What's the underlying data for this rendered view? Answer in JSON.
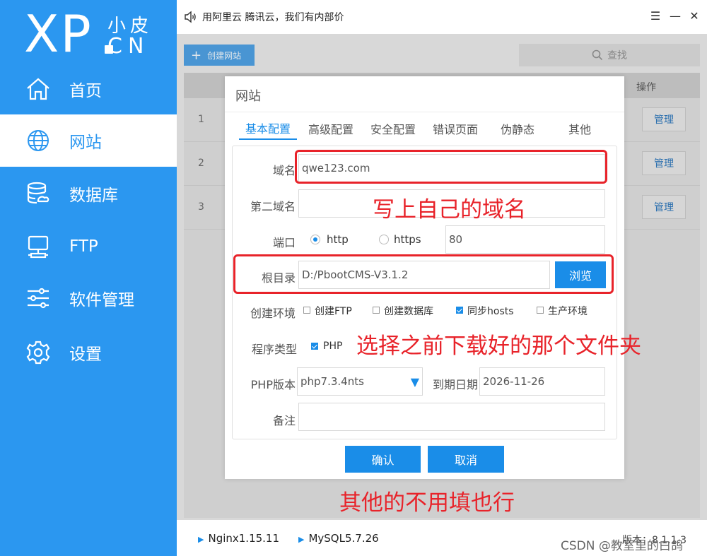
{
  "sidebar": {
    "logo": {
      "main": "XP",
      "cn_top": "小皮",
      "cn_bottom": "CN"
    },
    "items": [
      {
        "label": "首页",
        "icon": "home-icon"
      },
      {
        "label": "网站",
        "icon": "globe-icon",
        "active": true
      },
      {
        "label": "数据库",
        "icon": "database-icon"
      },
      {
        "label": "FTP",
        "icon": "ftp-server-icon"
      },
      {
        "label": "软件管理",
        "icon": "sliders-icon"
      },
      {
        "label": "设置",
        "icon": "gear-icon"
      }
    ]
  },
  "titlebar": {
    "notice": "用阿里云 腾讯云，我们有内部价",
    "menu_glyph": "☰",
    "minimize_glyph": "—",
    "close_glyph": "✕"
  },
  "toolbar": {
    "create_label": "创建网站",
    "search_label": "查找"
  },
  "table": {
    "op_header": "操作",
    "rows": [
      {
        "num": "1",
        "action": "管理"
      },
      {
        "num": "2",
        "action": "管理"
      },
      {
        "num": "3",
        "action": "管理"
      }
    ]
  },
  "dialog": {
    "title": "网站",
    "tabs": [
      "基本配置",
      "高级配置",
      "安全配置",
      "错误页面",
      "伪静态",
      "其他"
    ],
    "active_tab": "基本配置",
    "fields": {
      "domain_label": "域名",
      "domain_value": "qwe123.com",
      "second_domain_label": "第二域名",
      "second_domain_value": "",
      "port_label": "端口",
      "protocol_http": "http",
      "protocol_https": "https",
      "selected_protocol": "http",
      "port_value": "80",
      "root_label": "根目录",
      "root_value": "D:/PbootCMS-V3.1.2",
      "browse_label": "浏览",
      "env_label": "创建环境",
      "env_options": [
        {
          "label": "创建FTP",
          "checked": false
        },
        {
          "label": "创建数据库",
          "checked": false
        },
        {
          "label": "同步hosts",
          "checked": true
        },
        {
          "label": "生产环境",
          "checked": false
        }
      ],
      "program_type_label": "程序类型",
      "program_type_option": "PHP",
      "program_type_checked": true,
      "php_version_label": "PHP版本",
      "php_version_value": "php7.3.4nts",
      "expire_label": "到期日期",
      "expire_value": "2026-11-26",
      "note_label": "备注",
      "note_value": ""
    },
    "confirm_label": "确认",
    "cancel_label": "取消"
  },
  "annotations": {
    "domain_hint": "写上自己的域名",
    "folder_hint": "选择之前下载好的那个文件夹",
    "others_hint": "其他的不用填也行"
  },
  "statusbar": {
    "nginx": "Nginx1.15.11",
    "mysql": "MySQL5.7.26",
    "version": "版本：8.1.1.3"
  },
  "watermark": "CSDN @教室里的白鸽",
  "colors": {
    "brand": "#2b97f0",
    "primary": "#1a8de8",
    "annotation": "#e8232a"
  }
}
